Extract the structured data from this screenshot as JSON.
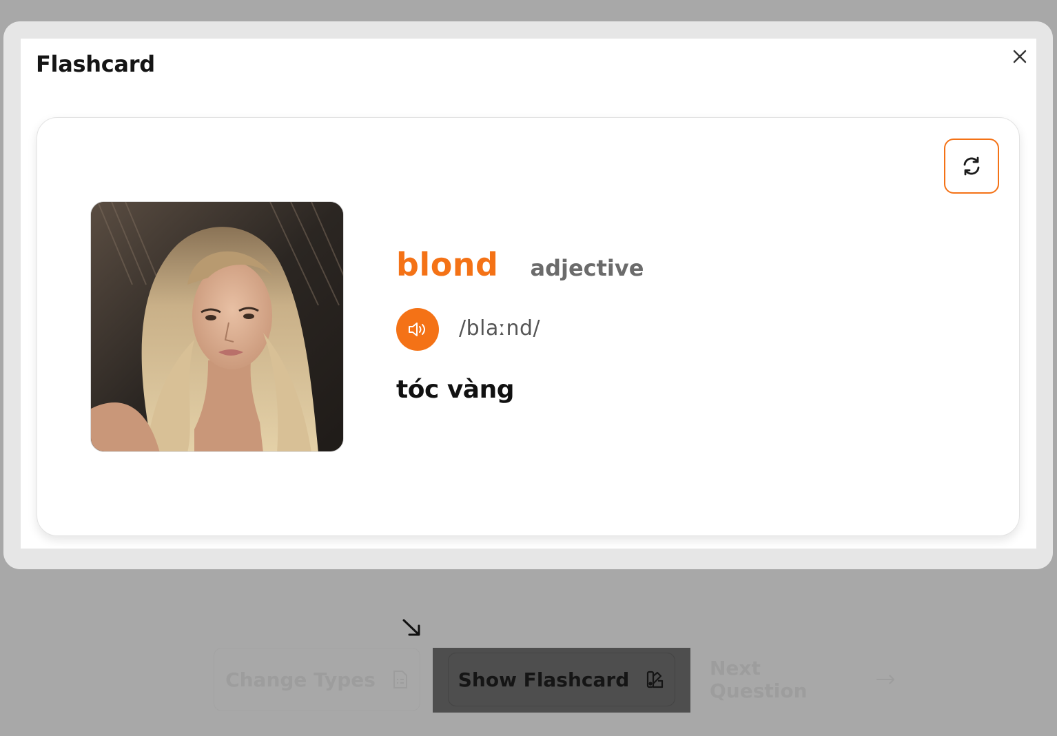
{
  "modal": {
    "title": "Flashcard"
  },
  "card": {
    "word": "blond",
    "part_of_speech": "adjective",
    "phonetic": "/blaːnd/",
    "meaning": "tóc vàng"
  },
  "toolbar": {
    "change_types_label": "Change Types",
    "show_flashcard_label": "Show Flashcard",
    "next_question_label": "Next Question"
  },
  "colors": {
    "accent": "#f47216",
    "backdrop": "#a8a8a8",
    "muted_text": "#9d9d9d"
  },
  "icons": {
    "close": "close-icon",
    "flip": "refresh-icon",
    "audio": "speaker-icon",
    "change_types": "document-list-icon",
    "show_flashcard": "swatch-book-icon",
    "next_question": "arrow-right-icon",
    "cursor": "arrow-down-right-icon"
  }
}
